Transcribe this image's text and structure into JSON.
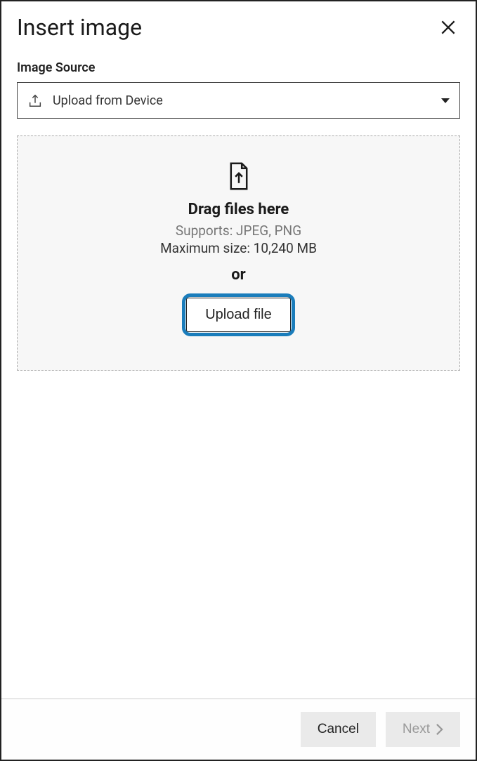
{
  "dialog": {
    "title": "Insert image"
  },
  "source": {
    "label": "Image Source",
    "selected": "Upload from Device"
  },
  "dropzone": {
    "title": "Drag files here",
    "supports": "Supports: JPEG, PNG",
    "max_size": "Maximum size: 10,240 MB",
    "or": "or",
    "upload_button": "Upload file"
  },
  "footer": {
    "cancel": "Cancel",
    "next": "Next"
  }
}
